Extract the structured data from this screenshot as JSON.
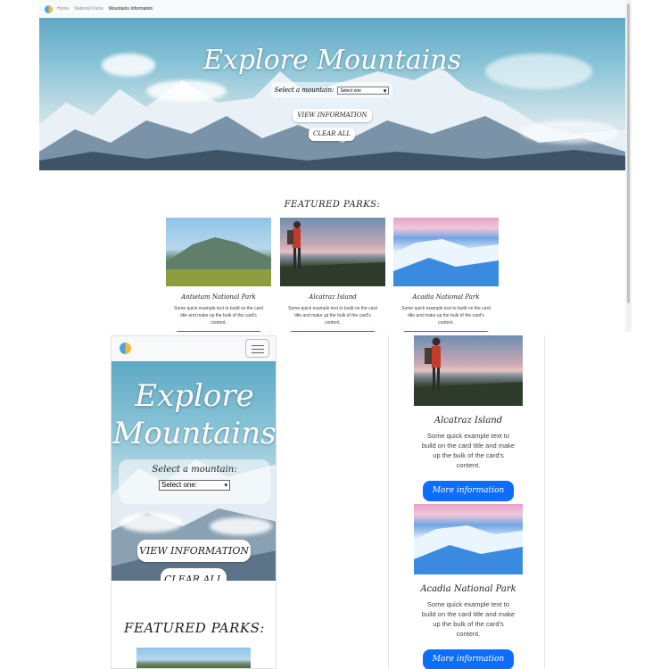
{
  "desktop": {
    "nav": {
      "items": [
        "Home",
        "National Parks",
        "Mountains Information"
      ]
    },
    "hero": {
      "title": "Explore Mountains",
      "select_label": "Select a mountain:",
      "select_value": "Select one",
      "view_button": "VIEW INFORMATION",
      "clear_button": "CLEAR ALL"
    },
    "featured_heading": "FEATURED PARKS:",
    "cards": [
      {
        "title": "Antietam National Park",
        "text": "Some quick example text to build on the card title and make up the bulk of the card's content."
      },
      {
        "title": "Alcatraz Island",
        "text": "Some quick example text to build on the card title and make up the bulk of the card's content."
      },
      {
        "title": "Acadia National Park",
        "text": "Some quick example text to build on the card title and make up the bulk of the card's content."
      }
    ]
  },
  "mobile": {
    "hero": {
      "title": "Explore Mountains",
      "select_label": "Select a mountain:",
      "select_value": "Select one:",
      "view_button": "VIEW INFORMATION",
      "clear_button": "CLEAR ALL"
    },
    "featured_heading": "FEATURED PARKS:"
  },
  "mobile_cards": [
    {
      "title": "Alcatraz Island",
      "text": "Some quick example text to build on the card title and make up the bulk of the card's content.",
      "button": "More information"
    },
    {
      "title": "Acadia National Park",
      "text": "Some quick example text to build on the card title and make up the bulk of the card's content.",
      "button": "More information"
    }
  ],
  "colors": {
    "primary_button": "#0d6efd",
    "nav_bg": "#f8f9fa"
  }
}
